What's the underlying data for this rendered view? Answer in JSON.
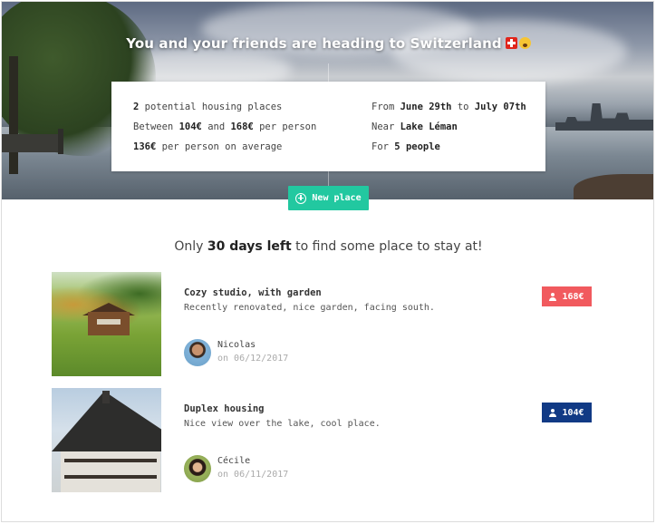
{
  "hero": {
    "title": "You and your friends are heading to Switzerland",
    "flag_icon": "swiss-flag-icon",
    "emoji_icon": "screaming-face-emoji-icon"
  },
  "info": {
    "left": [
      {
        "pre": "",
        "b1": "2",
        "mid": " potential housing places",
        "b2": "",
        "post": ""
      },
      {
        "pre": "Between ",
        "b1": "104€",
        "mid": " and ",
        "b2": "168€",
        "post": " per person"
      },
      {
        "pre": "",
        "b1": "136€",
        "mid": " per person on average",
        "b2": "",
        "post": ""
      }
    ],
    "right": [
      {
        "pre": "From ",
        "b1": "June 29th",
        "mid": " to ",
        "b2": "July 07th",
        "post": ""
      },
      {
        "pre": "Near ",
        "b1": "Lake Léman",
        "mid": "",
        "b2": "",
        "post": ""
      },
      {
        "pre": "For ",
        "b1": "5 people",
        "mid": "",
        "b2": "",
        "post": ""
      }
    ]
  },
  "new_place_button": "New place",
  "deadline": {
    "pre": "Only ",
    "bold": "30 days left",
    "post": " to find some place to stay at!"
  },
  "listings": [
    {
      "title": "Cozy studio, with garden",
      "description": "Recently renovated, nice garden, facing south.",
      "author": "Nicolas",
      "date": "on 06/12/2017",
      "price": "168€",
      "price_color": "#f15a5e"
    },
    {
      "title": "Duplex housing",
      "description": "Nice view over the lake, cool place.",
      "author": "Cécile",
      "date": "on 06/11/2017",
      "price": "104€",
      "price_color": "#113a85"
    }
  ],
  "colors": {
    "accent": "#22c8a0"
  }
}
